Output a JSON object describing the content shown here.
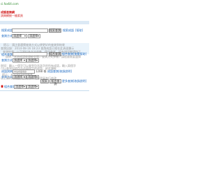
{
  "site": {
    "domain": "ci.fox64.com",
    "tagline": "成語查詢網",
    "tagline2": "詞典網統一檢索頁"
  },
  "search1": {
    "label": "搜索成語：",
    "input_value": "",
    "button": "搜索查詢",
    "link1": "搜索成語",
    "link2": "[幫助]",
    "type_label": "查詢方式：",
    "select1": "請選擇",
    "select2": "請選擇"
  },
  "notice": {
    "line1": "提示：請注意選擇查詢方式以便更好的查詢到結果",
    "line2": "查詢記錄：2014-08-16 18:23 查詢成語已經在此頁面顯示",
    "line3": "查詢結果：以下資料為本站收集，僅供參考，如有錯誤敬請指正"
  },
  "search2": {
    "label": "組合查詢：",
    "input_value": "",
    "button": "組合查詢",
    "link": "組合查詢[查看幫助]",
    "type_label": "查詢方式：",
    "select1": "請選擇",
    "select2": "請選擇"
  },
  "info": {
    "line1": "說明：本站成語收錄較全面，查詢方式多樣，請根據需要選擇",
    "line2": "例如：輸入一個字可以查到包含該字的所有成語，輸入兩個字",
    "line3": "可以查到同時包含這兩個字的成語，依此類推"
  },
  "search3": {
    "label": "成語詞典：",
    "input_value": "本站成語收錄",
    "extra": "1288 條",
    "link": "成語查詢[收錄說明]",
    "type_label": "查詢方式：",
    "select1": "請選擇",
    "select2": "請選擇"
  },
  "note": {
    "line1": "提示：本站資料僅供參考",
    "line2": "以上資料如有疑問請聯繫本站管理員進行修改"
  },
  "search4": {
    "button1": "搜索",
    "button2": "組合查詢",
    "link": "更多查詢[收錄說明]"
  },
  "footer": {
    "label": "組合查詢：",
    "select1": "請選擇",
    "select2": "請選擇"
  }
}
